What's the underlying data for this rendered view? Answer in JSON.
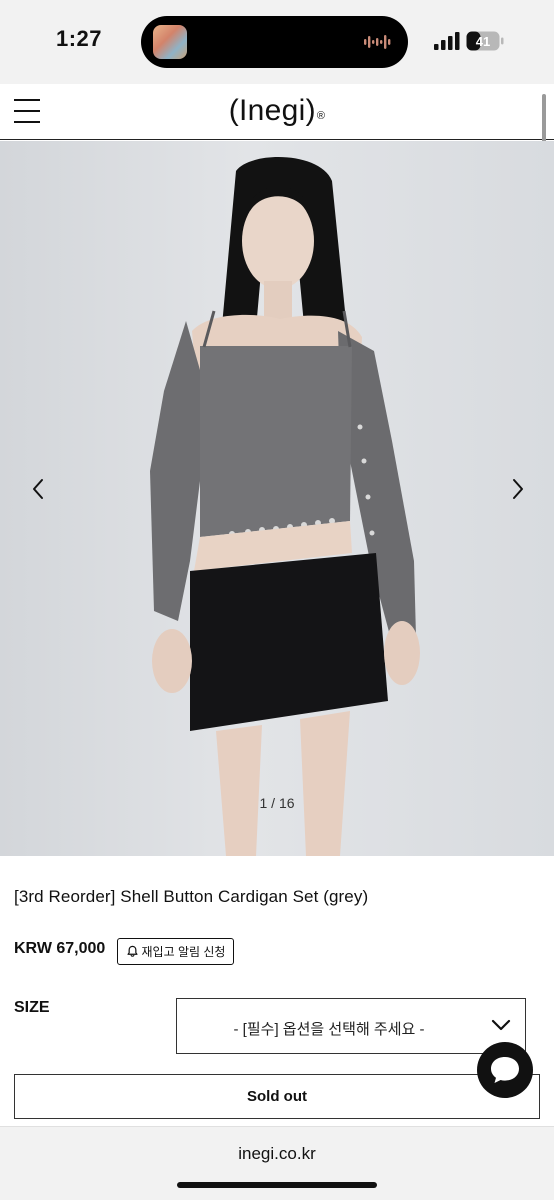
{
  "status_bar": {
    "time": "1:27",
    "battery_level": "41"
  },
  "header": {
    "brand": "(Inegi)",
    "brand_mark": "®"
  },
  "gallery": {
    "counter": "1 / 16",
    "current": 1,
    "total": 16
  },
  "product": {
    "name": "[3rd Reorder] Shell Button Cardigan Set (grey)",
    "price": "KRW 67,000",
    "restock_label": "재입고 알림 신청"
  },
  "options": {
    "size_label": "SIZE",
    "size_select_value": "- [필수] 옵션을 선택해 주세요 -"
  },
  "actions": {
    "soldout_label": "Sold out"
  },
  "browser": {
    "url": "inegi.co.kr"
  },
  "icons": {
    "menu": "hamburger-menu-icon",
    "prev": "chevron-left-icon",
    "next": "chevron-right-icon",
    "bell": "bell-icon",
    "dropdown": "chevron-down-icon",
    "chat": "chat-bubble-icon"
  },
  "colors": {
    "background": "#ffffff",
    "text": "#111111",
    "status_bar_bg": "#f2f2f2",
    "photo_bg": "#dcdfe2"
  }
}
